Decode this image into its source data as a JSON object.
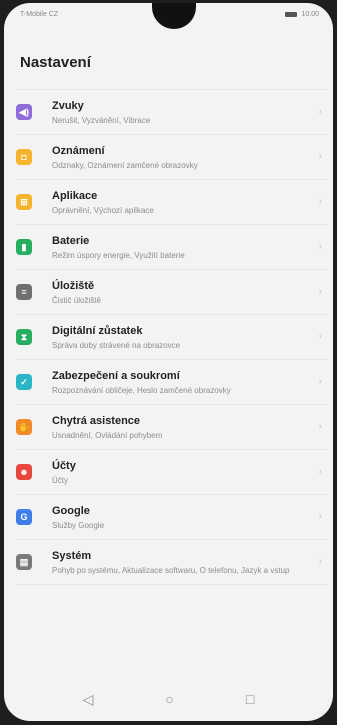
{
  "status_bar": {
    "carrier": "T-Mobile CZ",
    "time": "10:00"
  },
  "header": {
    "title": "Nastavení"
  },
  "settings": [
    {
      "label": "Zvuky",
      "sub": "Nerušit, Vyzvánění, Vibrace",
      "color": "#8e6ddb",
      "icon": "volume-icon"
    },
    {
      "label": "Oznámení",
      "sub": "Odznaky, Oznámení zamčené obrazovky",
      "color": "#f4b42e",
      "icon": "notification-icon"
    },
    {
      "label": "Aplikace",
      "sub": "Oprávnění, Výchozí aplikace",
      "color": "#f4b42e",
      "icon": "apps-icon"
    },
    {
      "label": "Baterie",
      "sub": "Režim úspory energie, Využití baterie",
      "color": "#27ae60",
      "icon": "battery-icon"
    },
    {
      "label": "Úložiště",
      "sub": "Čistič úložiště",
      "color": "#6f6f6f",
      "icon": "storage-icon"
    },
    {
      "label": "Digitální zůstatek",
      "sub": "Správa doby strávené na obrazovce",
      "color": "#27ae60",
      "icon": "hourglass-icon"
    },
    {
      "label": "Zabezpečení a soukromí",
      "sub": "Rozpoznávání obličeje, Heslo zamčené obrazovky",
      "color": "#2bb5c5",
      "icon": "shield-icon"
    },
    {
      "label": "Chytrá asistence",
      "sub": "Usnadnění, Ovládání pohybem",
      "color": "#f08a2b",
      "icon": "hand-icon"
    },
    {
      "label": "Účty",
      "sub": "Účty",
      "color": "#e7473c",
      "icon": "user-icon"
    },
    {
      "label": "Google",
      "sub": "Služby Google",
      "color": "#3f7ee8",
      "icon": "google-icon"
    },
    {
      "label": "Systém",
      "sub": "Pohyb po systému, Aktualizace softwaru, O telefonu, Jazyk a vstup",
      "color": "#7a7a7a",
      "icon": "system-icon"
    }
  ],
  "navbar": {
    "back": "◁",
    "home": "○",
    "recents": "□"
  }
}
